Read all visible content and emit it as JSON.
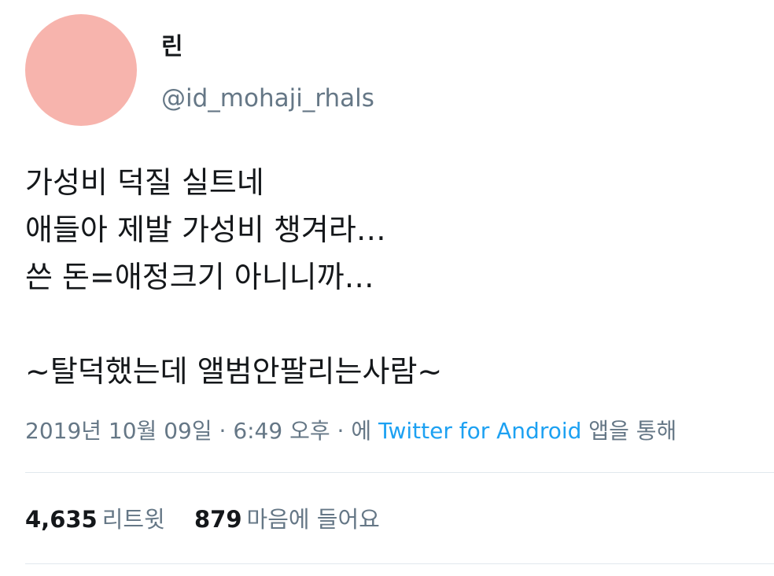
{
  "user": {
    "display_name": "린",
    "handle": "@id_mohaji_rhals",
    "avatar_color": "#f7b4ad"
  },
  "tweet": {
    "lines": [
      "가성비 덕질 실트네",
      "애들아 제발 가성비 챙겨라…",
      "쓴 돈=애정크기 아니니까…",
      "",
      "~탈덕했는데 앨범안팔리는사람~"
    ]
  },
  "meta": {
    "date": "2019년 10월 09일",
    "separator": " · ",
    "time": "6:49 오후",
    "via_prefix": "에 ",
    "source": "Twitter for Android",
    "via_suffix": " 앱을 통해"
  },
  "stats": {
    "retweets_count": "4,635",
    "retweets_label": "리트윗",
    "likes_count": "879",
    "likes_label": "마음에 들어요"
  },
  "colors": {
    "link": "#1da1f2",
    "secondary_text": "#657786",
    "divider": "#e1e8ed"
  }
}
